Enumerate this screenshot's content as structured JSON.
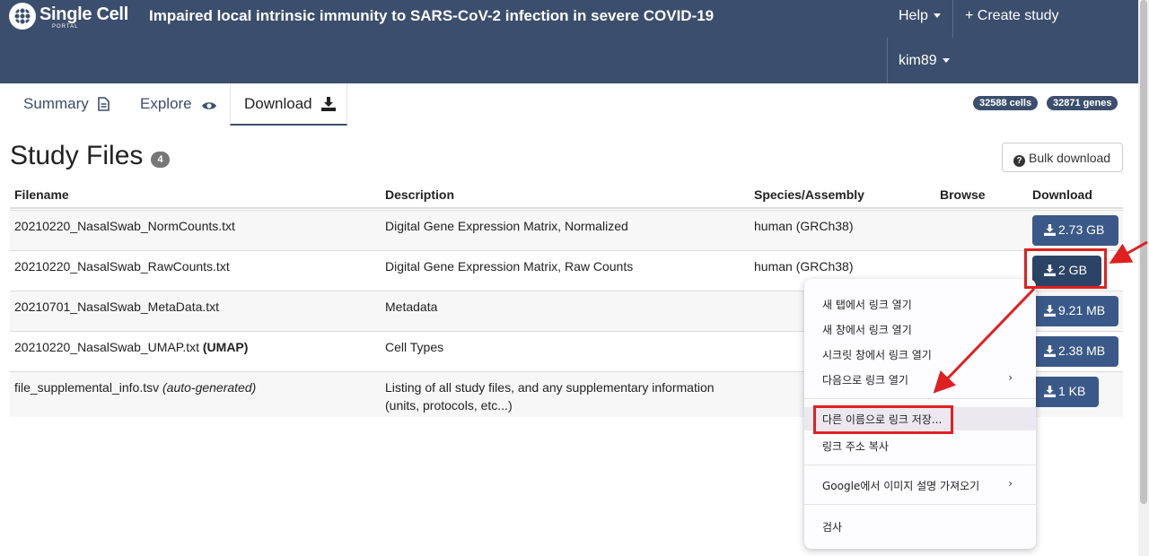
{
  "header": {
    "logo_text": "Single Cell",
    "logo_sub": "PORTAL",
    "study_title": "Impaired local intrinsic immunity to SARS-CoV-2 infection in severe COVID-19",
    "help_label": "Help",
    "create_label": "+ Create study",
    "user_label": "kim89"
  },
  "tabs": [
    {
      "label": "Summary"
    },
    {
      "label": "Explore"
    },
    {
      "label": "Download"
    }
  ],
  "stats": {
    "cells": "32588 cells",
    "genes": "32871 genes"
  },
  "files_section": {
    "title": "Study Files",
    "count": "4",
    "bulk_label": "Bulk download"
  },
  "table": {
    "headers": [
      "Filename",
      "Description",
      "Species/Assembly",
      "Browse",
      "Download"
    ],
    "rows": [
      {
        "filename": "20210220_NasalSwab_NormCounts.txt",
        "tag": "",
        "description": "Digital Gene Expression Matrix, Normalized",
        "description2": "",
        "species": "human (GRCh38)",
        "size": "2.73 GB"
      },
      {
        "filename": "20210220_NasalSwab_RawCounts.txt",
        "tag": "",
        "description": "Digital Gene Expression Matrix, Raw Counts",
        "description2": "",
        "species": "human (GRCh38)",
        "size": "2 GB"
      },
      {
        "filename": "20210701_NasalSwab_MetaData.txt",
        "tag": "",
        "description": "Metadata",
        "description2": "",
        "species": "",
        "size": "9.21 MB"
      },
      {
        "filename": "20210220_NasalSwab_UMAP.txt",
        "tag": "(UMAP)",
        "description": "Cell Types",
        "description2": "",
        "species": "",
        "size": "2.38 MB"
      },
      {
        "filename": "file_supplemental_info.tsv",
        "tag": "(auto-generated)",
        "description": "Listing of all study files, and any supplementary information",
        "description2": "(units, protocols, etc...)",
        "species": "",
        "size": "1 KB"
      }
    ]
  },
  "context_menu": {
    "items": [
      {
        "label": "새 탭에서 링크 열기"
      },
      {
        "label": "새 창에서 링크 열기"
      },
      {
        "label": "시크릿 창에서 링크 열기"
      },
      {
        "label": "다음으로 링크 열기"
      },
      {
        "label": "다른 이름으로 링크 저장..."
      },
      {
        "label": "링크 주소 복사"
      },
      {
        "label": "Google에서 이미지 설명 가져오기"
      },
      {
        "label": "검사"
      }
    ],
    "submenu_glyph": "›"
  },
  "colors": {
    "header_bg": "#3b4e6d",
    "button_bg": "#3b5988",
    "annotation_red": "#e02020"
  }
}
